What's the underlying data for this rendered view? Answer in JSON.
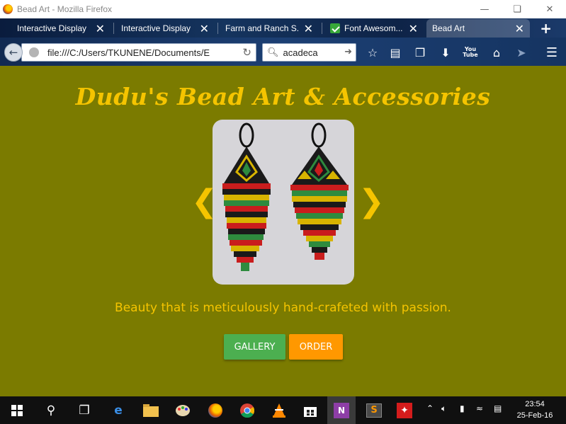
{
  "window": {
    "title": "Bead Art - Mozilla Firefox",
    "minimize_icon": "minimize-icon",
    "restore_icon": "restore-icon",
    "close_icon": "close-icon"
  },
  "tabs": [
    {
      "label": "Interactive Display"
    },
    {
      "label": "Interactive Display"
    },
    {
      "label": "Farm and Ranch S..."
    },
    {
      "label": "Font Awesom..."
    },
    {
      "label": "Bead Art"
    }
  ],
  "toolbar": {
    "url": "file:///C:/Users/TKUNENE/Documents/E",
    "search_value": "acadeca",
    "youtube_label_1": "You",
    "youtube_label_2": "Tube"
  },
  "page": {
    "heading": "Dudu's Bead Art & Accessories",
    "tagline": "Beauty that is meticulously hand-crafeted with passion.",
    "gallery_button": "GALLERY",
    "order_button": "ORDER",
    "prev_arrow": "❮",
    "next_arrow": "❯"
  },
  "taskbar": {
    "time": "23:54",
    "date": "25-Feb-16"
  },
  "colors": {
    "page_background": "#7b7b00",
    "accent_yellow": "#f5c400",
    "gallery_green": "#4caf50",
    "order_orange": "#ff9800"
  }
}
